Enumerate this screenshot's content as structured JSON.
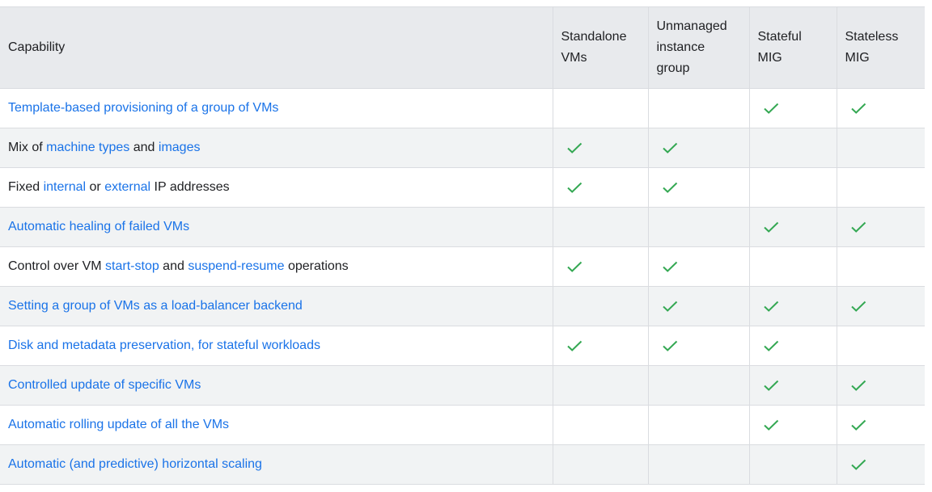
{
  "table": {
    "headers": [
      "Capability",
      "Standalone VMs",
      "Unmanaged instance group",
      "Stateful MIG",
      "Stateless MIG"
    ],
    "check_color": "#34a853",
    "link_color": "#1a73e8",
    "rows": [
      {
        "segments": [
          {
            "text": "Template-based provisioning of a group of VMs",
            "link": true
          }
        ],
        "checks": [
          false,
          false,
          true,
          true
        ]
      },
      {
        "segments": [
          {
            "text": "Mix of ",
            "link": false
          },
          {
            "text": "machine types",
            "link": true
          },
          {
            "text": " and ",
            "link": false
          },
          {
            "text": "images",
            "link": true
          }
        ],
        "checks": [
          true,
          true,
          false,
          false
        ]
      },
      {
        "segments": [
          {
            "text": "Fixed ",
            "link": false
          },
          {
            "text": "internal",
            "link": true
          },
          {
            "text": " or ",
            "link": false
          },
          {
            "text": "external",
            "link": true
          },
          {
            "text": " IP addresses",
            "link": false
          }
        ],
        "checks": [
          true,
          true,
          false,
          false
        ]
      },
      {
        "segments": [
          {
            "text": "Automatic healing of failed VMs",
            "link": true
          }
        ],
        "checks": [
          false,
          false,
          true,
          true
        ]
      },
      {
        "segments": [
          {
            "text": "Control over VM ",
            "link": false
          },
          {
            "text": "start-stop",
            "link": true
          },
          {
            "text": " and ",
            "link": false
          },
          {
            "text": "suspend-resume",
            "link": true
          },
          {
            "text": " operations",
            "link": false
          }
        ],
        "checks": [
          true,
          true,
          false,
          false
        ]
      },
      {
        "segments": [
          {
            "text": "Setting a group of VMs as a load-balancer backend",
            "link": true
          }
        ],
        "checks": [
          false,
          true,
          true,
          true
        ]
      },
      {
        "segments": [
          {
            "text": "Disk and metadata preservation, for stateful workloads",
            "link": true
          }
        ],
        "checks": [
          true,
          true,
          true,
          false
        ]
      },
      {
        "segments": [
          {
            "text": "Controlled update of specific VMs",
            "link": true
          }
        ],
        "checks": [
          false,
          false,
          true,
          true
        ]
      },
      {
        "segments": [
          {
            "text": "Automatic rolling update of all the VMs",
            "link": true
          }
        ],
        "checks": [
          false,
          false,
          true,
          true
        ]
      },
      {
        "segments": [
          {
            "text": "Automatic (and predictive) horizontal scaling",
            "link": true
          }
        ],
        "checks": [
          false,
          false,
          false,
          true
        ]
      }
    ]
  }
}
